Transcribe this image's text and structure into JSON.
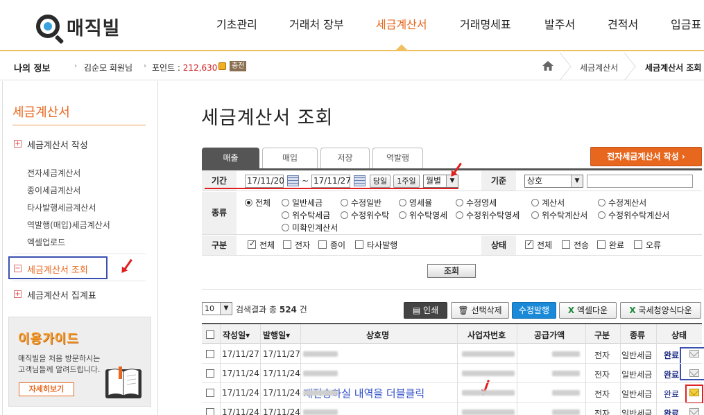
{
  "header": {
    "logo_text": "매직빌",
    "nav": [
      "기초관리",
      "거래처 장부",
      "세금계산서",
      "거래명세표",
      "발주서",
      "견적서",
      "입금표"
    ],
    "nav_active": "세금계산서"
  },
  "subbar": {
    "my_info": "나의 정보",
    "member": "김순모 회원님",
    "point_label": "포인트 : ",
    "point_value": "212,630",
    "charge": "충전",
    "breadcrumb": [
      "세금계산서",
      "세금계산서 조회"
    ]
  },
  "sidebar": {
    "title": "세금계산서",
    "groups": [
      {
        "label": "세금계산서 작성",
        "children": [
          "전자세금계산서",
          "종이세금계산서",
          "타사발행세금계산서",
          "역발행(매입)세금계산서",
          "엑셀업로드"
        ]
      },
      {
        "label": "세금계산서 조회",
        "active": true
      },
      {
        "label": "세금계산서 집계표"
      }
    ],
    "guide": {
      "title": "이용가이드",
      "desc_line1": "매직빌을 처음 방문하시는",
      "desc_line2": "고객님들께 알려드립니다.",
      "button": "자세히보기"
    }
  },
  "main": {
    "page_title": "세금계산서 조회",
    "tabs": [
      "매출",
      "매입",
      "저장",
      "역발행"
    ],
    "active_tab": "매출",
    "create_button": "전자세금계산서 작성",
    "create_arrow": "›",
    "form": {
      "period_label": "기간",
      "date_from": "17/11/20",
      "date_sep": "~",
      "date_to": "17/11/27",
      "btn_today": "당일",
      "btn_week": "1주일",
      "period_select": "월별",
      "basis_label": "기준",
      "basis_select": "상호",
      "basis_input": "",
      "type_label": "종류",
      "type_options_row1": [
        "전체",
        "일반세금",
        "수정일반",
        "영세율",
        "수정영세",
        "계산서",
        "수정계산서"
      ],
      "type_options_row2": [
        "위수탁세금",
        "수정위수탁",
        "위수탁영세",
        "수정위수탁영세",
        "위수탁계산서",
        "수정위수탁계산서"
      ],
      "type_options_row3": [
        "미확인계산서"
      ],
      "kind_label": "구분",
      "kind_options": [
        "전체",
        "전자",
        "종이",
        "타사발행"
      ],
      "status_label": "상태",
      "status_options": [
        "전체",
        "전송",
        "완료",
        "오류"
      ]
    },
    "search_button": "조회",
    "toolbar": {
      "page_size": "10",
      "result_prefix": "검색결과 총",
      "result_count": "524",
      "result_suffix": "건",
      "print": "인쇄",
      "delete_selected": "선택삭제",
      "modify_issue": "수정발행",
      "excel_down": "엑셀다운",
      "nts_form_down": "국세청양식다운"
    },
    "table": {
      "headers": [
        "작성일",
        "발행일",
        "상호명",
        "사업자번호",
        "공급가액",
        "구분",
        "종류",
        "상태"
      ],
      "sort_mark": "▾",
      "rows": [
        {
          "write_date": "17/11/27",
          "issue_date": "17/11/27",
          "kind": "전자",
          "type": "일반세금",
          "status": "완료"
        },
        {
          "write_date": "17/11/24",
          "issue_date": "17/11/24",
          "kind": "전자",
          "type": "일반세금",
          "status": "완료"
        },
        {
          "write_date": "17/11/24",
          "issue_date": "17/11/24",
          "kind": "전자",
          "type": "일반세금",
          "status": "완료"
        },
        {
          "write_date": "17/11/24",
          "issue_date": "17/11/24",
          "kind": "전자",
          "type": "일반세금",
          "status": "완료"
        }
      ],
      "annotation": "재전송하실 내역을 더블클릭"
    }
  },
  "colors": {
    "accent": "#e8671e",
    "blue_annot": "#3a50b0",
    "red_annot": "#e02020",
    "button_blue": "#1a8ad8"
  }
}
